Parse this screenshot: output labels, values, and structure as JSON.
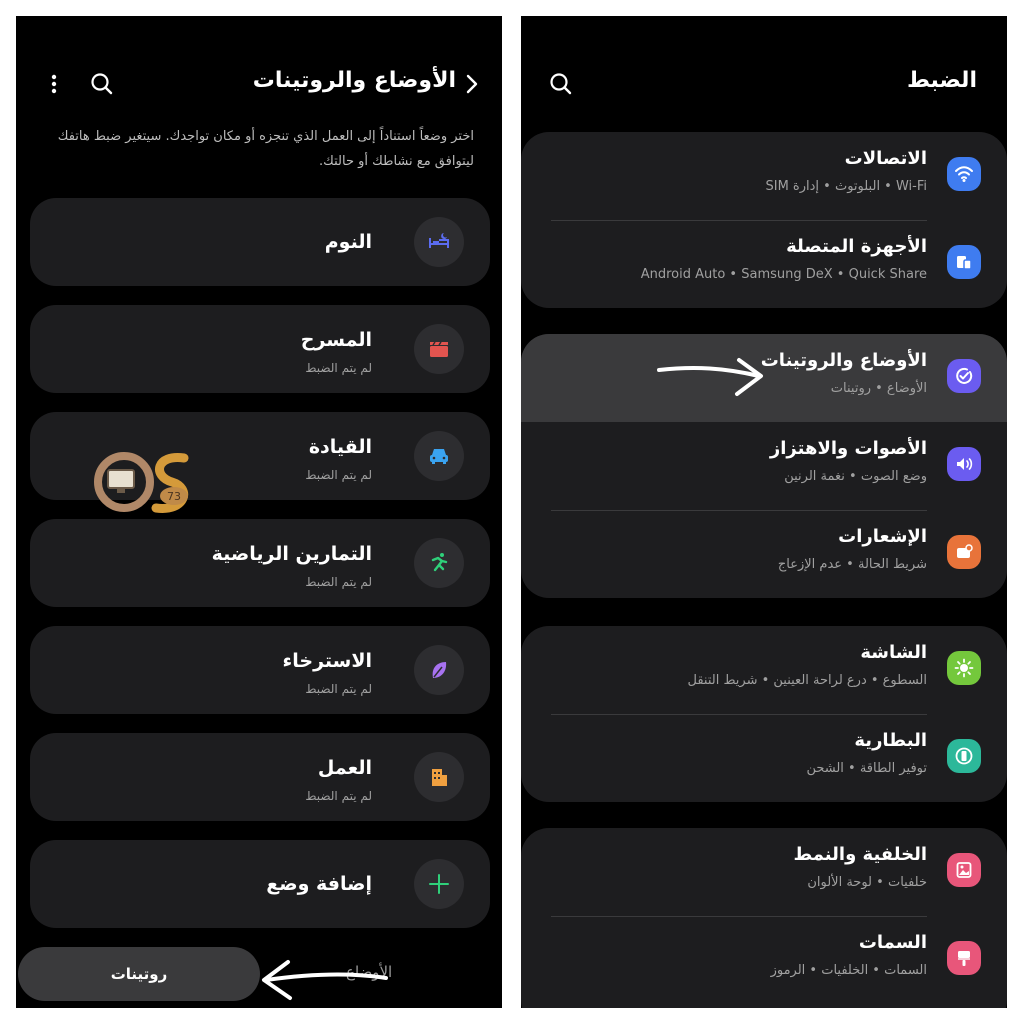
{
  "left_screen": {
    "title": "الأوضاع والروتينات",
    "description": "اختر وضعاً استناداً إلى العمل الذي تنجزه أو مكان تواجدك. سيتغير ضبط هاتفك ليتوافق مع نشاطك أو حالتك.",
    "modes": [
      {
        "title": "النوم",
        "subtitle": "",
        "icon": "bed-icon",
        "color": "#5b6cf0"
      },
      {
        "title": "المسرح",
        "subtitle": "لم يتم الضبط",
        "icon": "clapperboard-icon",
        "color": "#e2544f"
      },
      {
        "title": "القيادة",
        "subtitle": "لم يتم الضبط",
        "icon": "car-icon",
        "color": "#3aa3f0"
      },
      {
        "title": "التمارين الرياضية",
        "subtitle": "لم يتم الضبط",
        "icon": "running-icon",
        "color": "#2fd07a"
      },
      {
        "title": "الاسترخاء",
        "subtitle": "لم يتم الضبط",
        "icon": "leaf-icon",
        "color": "#a772f0"
      },
      {
        "title": "العمل",
        "subtitle": "لم يتم الضبط",
        "icon": "building-icon",
        "color": "#f0a040"
      }
    ],
    "add_mode_label": "إضافة وضع",
    "tabs": {
      "routines": "روتينات",
      "modes": "الأوضاع"
    }
  },
  "watermark": {
    "text": "OS",
    "number": "73"
  },
  "right_screen": {
    "title": "الضبط",
    "groups": [
      [
        {
          "title": "الاتصالات",
          "subtitle": "Wi-Fi • البلوتوث • إدارة SIM",
          "icon": "wifi-icon",
          "color": "#3f7cf0"
        },
        {
          "title": "الأجهزة المتصلة",
          "subtitle": "Android Auto • Samsung DeX • Quick Share",
          "icon": "devices-icon",
          "color": "#3f7cf0"
        }
      ],
      [
        {
          "title": "الأوضاع والروتينات",
          "subtitle": "الأوضاع • روتينات",
          "icon": "check-circle-icon",
          "color": "#6b5cf0"
        },
        {
          "title": "الأصوات والاهتزاز",
          "subtitle": "وضع الصوت • نغمة الرنين",
          "icon": "speaker-icon",
          "color": "#6b5cf0"
        },
        {
          "title": "الإشعارات",
          "subtitle": "شريط الحالة • عدم الإزعاج",
          "icon": "notification-icon",
          "color": "#e8733a"
        }
      ],
      [
        {
          "title": "الشاشة",
          "subtitle": "السطوع • درع لراحة العينين • شريط التنقل",
          "icon": "sun-icon",
          "color": "#74c83c"
        },
        {
          "title": "البطارية",
          "subtitle": "توفير الطاقة • الشحن",
          "icon": "battery-icon",
          "color": "#2cb89a"
        }
      ],
      [
        {
          "title": "الخلفية والنمط",
          "subtitle": "خلفيات • لوحة الألوان",
          "icon": "wallpaper-icon",
          "color": "#e8567a"
        },
        {
          "title": "السمات",
          "subtitle": "السمات • الخلفيات • الرموز",
          "icon": "brush-icon",
          "color": "#e8567a"
        }
      ]
    ]
  }
}
